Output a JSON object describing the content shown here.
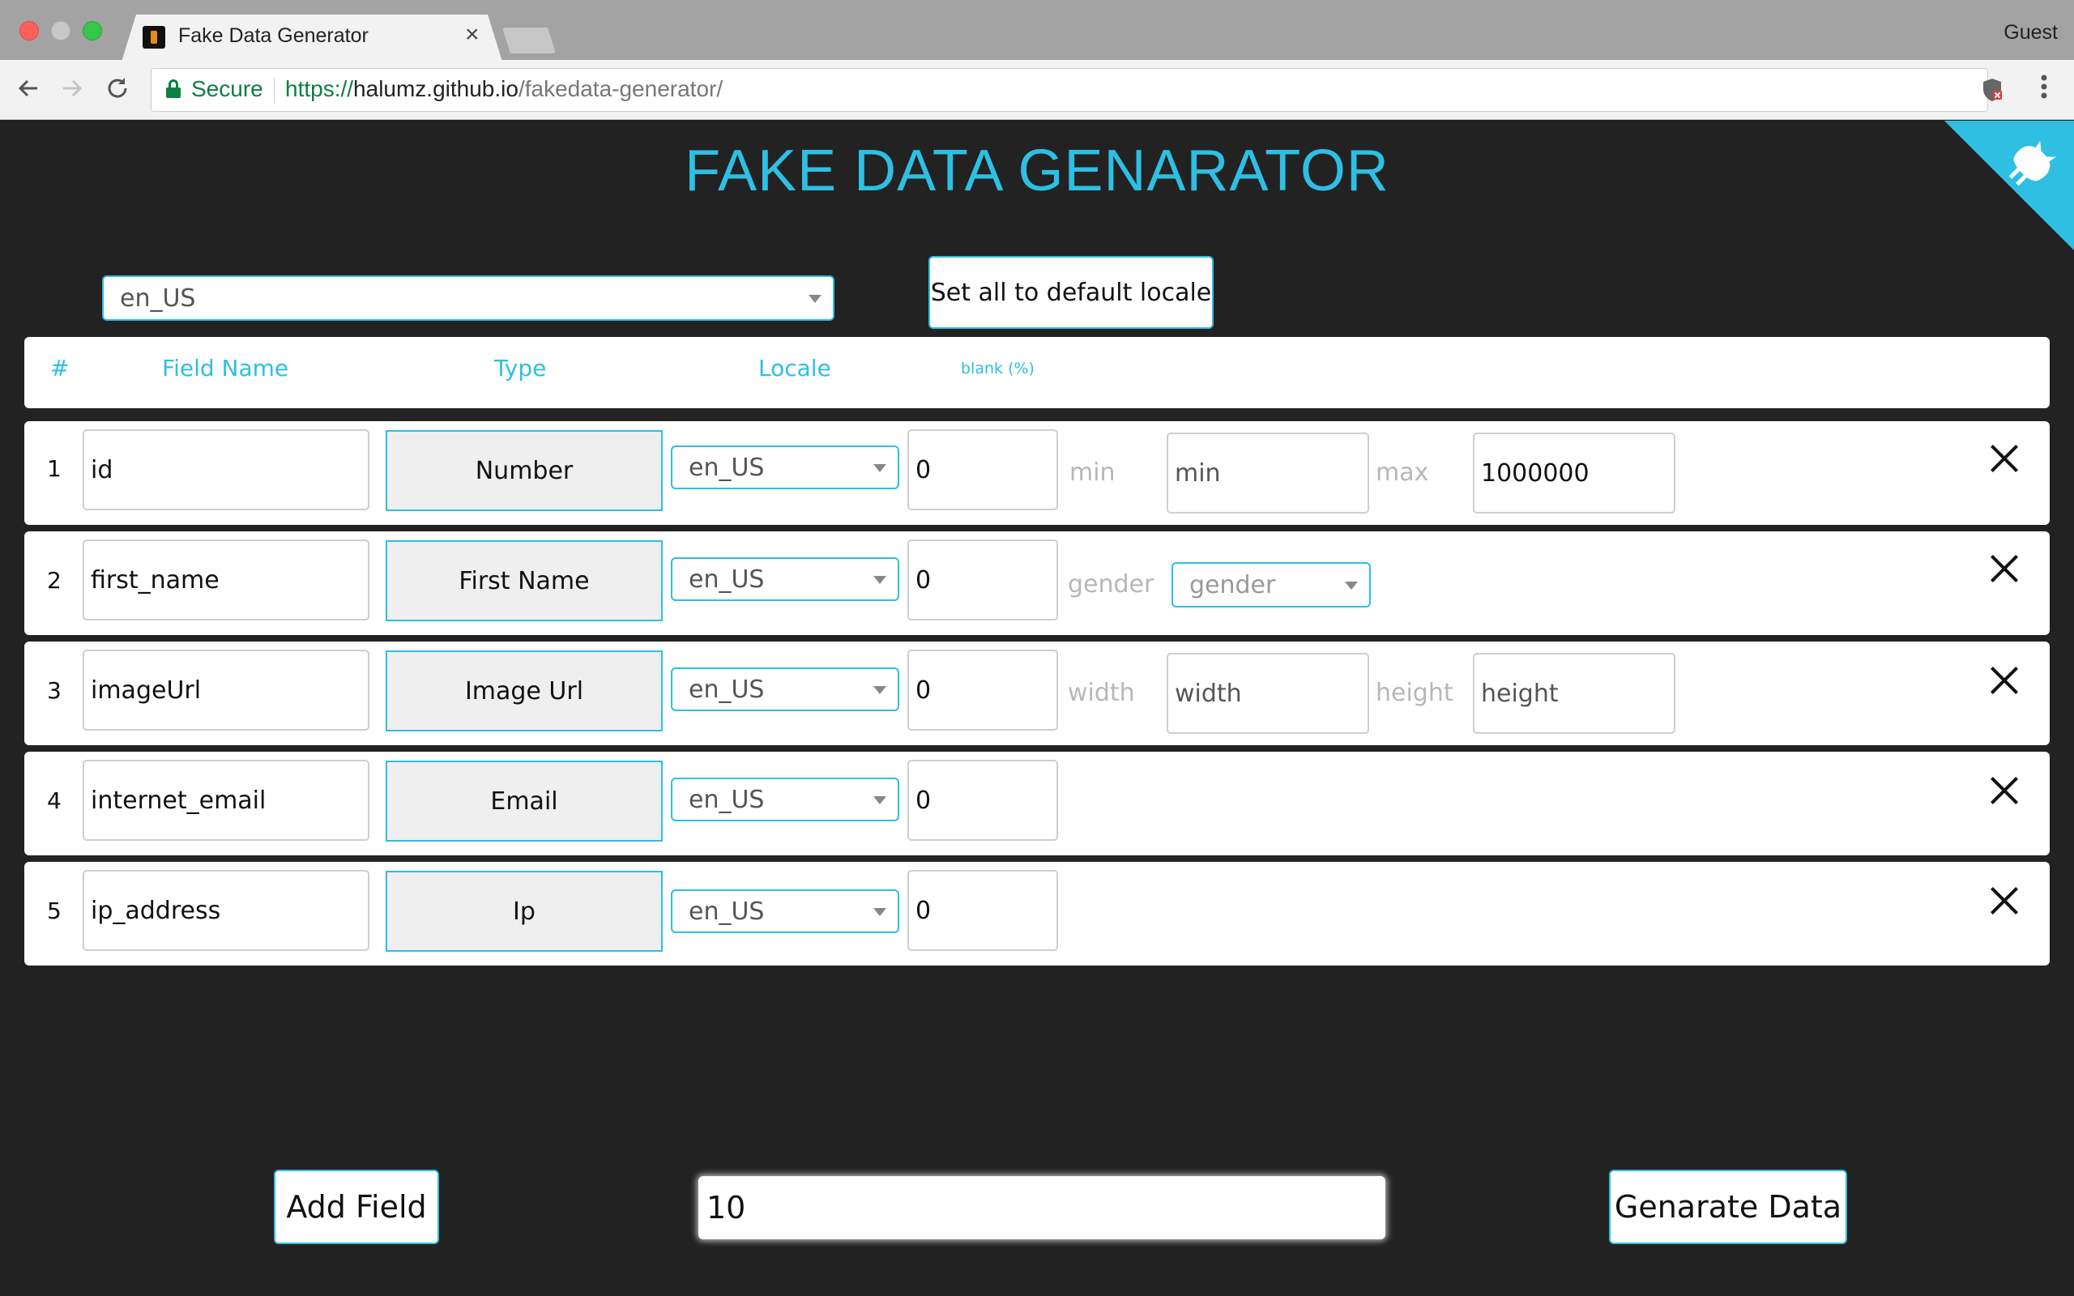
{
  "browser": {
    "tab_title": "Fake Data Generator",
    "tab_close": "×",
    "profile": "Guest",
    "secure_label": "Secure",
    "url_scheme": "https://",
    "url_host": "halumz.github.io",
    "url_path": "/fakedata-generator/"
  },
  "page": {
    "title": "FAKE DATA GENARATOR",
    "default_locale": "en_US",
    "set_default_button": "Set all to default locale",
    "headers": {
      "number": "#",
      "field_name": "Field Name",
      "type": "Type",
      "locale": "Locale",
      "blank": "blank (%)"
    },
    "rows": [
      {
        "num": "1",
        "field_name": "id",
        "type": "Number",
        "locale": "en_US",
        "blank": "0",
        "opt1_label": "min",
        "opt1_placeholder": "min",
        "opt2_label": "max",
        "opt2_value": "1000000"
      },
      {
        "num": "2",
        "field_name": "first_name",
        "type": "First Name",
        "locale": "en_US",
        "blank": "0",
        "opt1_label": "gender",
        "opt1_select": "gender"
      },
      {
        "num": "3",
        "field_name": "imageUrl",
        "type": "Image Url",
        "locale": "en_US",
        "blank": "0",
        "opt1_label": "width",
        "opt1_placeholder": "width",
        "opt2_label": "height",
        "opt2_placeholder": "height"
      },
      {
        "num": "4",
        "field_name": "internet_email",
        "type": "Email",
        "locale": "en_US",
        "blank": "0"
      },
      {
        "num": "5",
        "field_name": "ip_address",
        "type": "Ip",
        "locale": "en_US",
        "blank": "0"
      }
    ],
    "add_field_button": "Add Field",
    "row_count": "10",
    "generate_button": "Genarate Data"
  },
  "colors": {
    "accent": "#2ebfe3",
    "page_background": "#222222",
    "secure_green": "#0b8043"
  },
  "icons": [
    "back-arrow-icon",
    "forward-arrow-icon",
    "reload-icon",
    "lock-icon",
    "shield-icon",
    "kebab-menu-icon",
    "github-octocat-icon",
    "close-x-icon",
    "dropdown-caret-icon"
  ]
}
